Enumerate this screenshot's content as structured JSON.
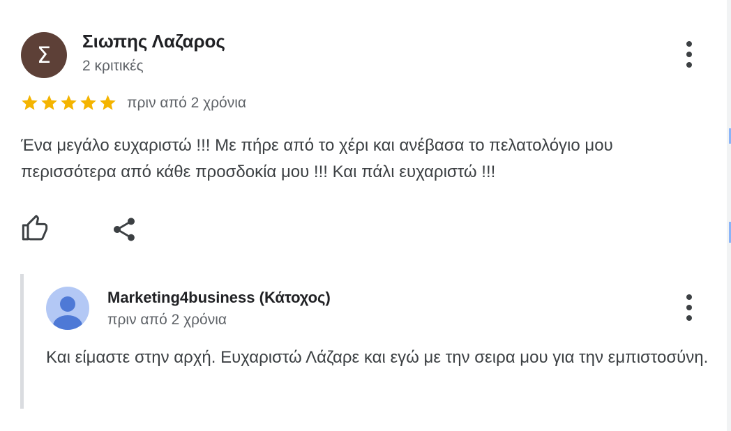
{
  "review": {
    "avatar_letter": "Σ",
    "avatar_color": "#5d4037",
    "reviewer_name": "Σιωπης Λαζαρος",
    "reviewer_meta": "2 κριτικές",
    "rating": 5,
    "rating_max": 5,
    "star_color": "#f4b400",
    "date": "πριν από 2 χρόνια",
    "text": "Ένα μεγάλο ευχαριστώ !!! Με πήρε από το χέρι και ανέβασα το πελατολόγιο μου περισσότερα από κάθε προσδοκία μου !!! Και πάλι ευχαριστώ !!!"
  },
  "actions": {
    "like_icon": "thumbs-up-icon",
    "share_icon": "share-icon",
    "more_icon": "more-vert-icon"
  },
  "owner_reply": {
    "avatar_icon": "default-user-icon",
    "avatar_color": "#b3c8f5",
    "name": "Marketing4business (Κάτοχος)",
    "date": "πριν από 2 χρόνια",
    "text": "Και είμαστε στην αρχή. Ευχαριστώ Λάζαρε και εγώ με την σειρα μου για την εμπιστοσύνη."
  }
}
